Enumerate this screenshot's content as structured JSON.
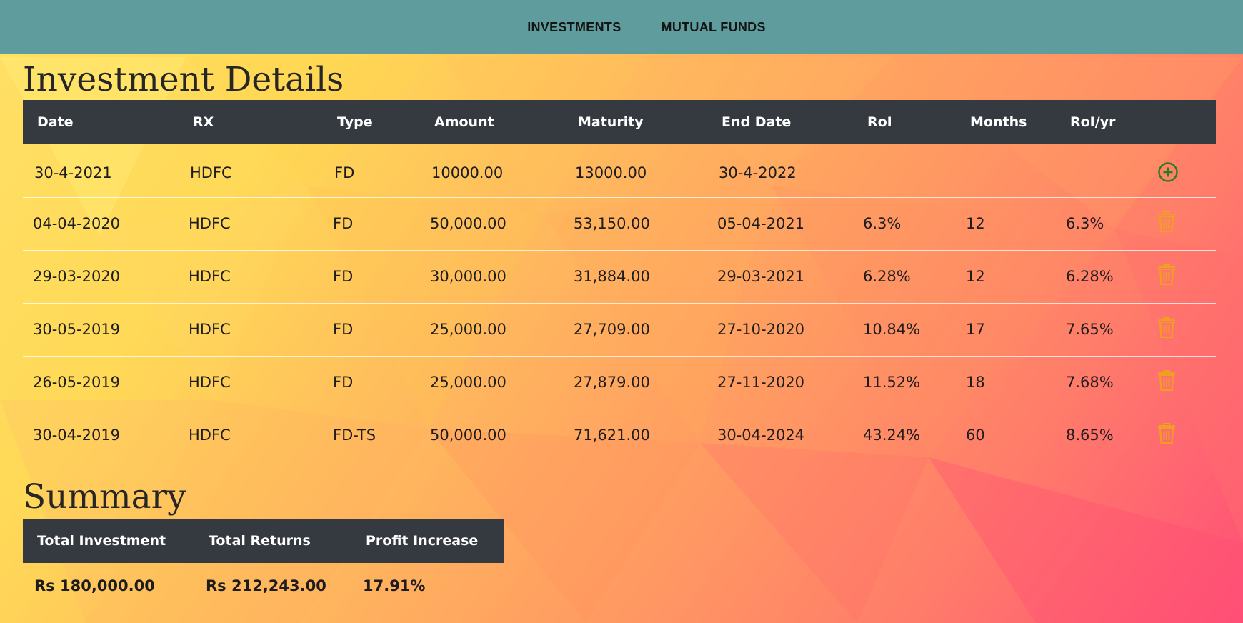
{
  "colors": {
    "navbar": "#5e9c9d",
    "table_header": "#343a40",
    "add_icon": "#2a7d1f",
    "delete_icon": "#f0a020"
  },
  "nav": {
    "items": [
      {
        "label": "INVESTMENTS"
      },
      {
        "label": "MUTUAL FUNDS"
      }
    ]
  },
  "details": {
    "title": "Investment Details",
    "columns": [
      "Date",
      "RX",
      "Type",
      "Amount",
      "Maturity",
      "End Date",
      "RoI",
      "Months",
      "RoI/yr"
    ],
    "new_entry": {
      "date": "30-4-2021",
      "rx": "HDFC",
      "type": "FD",
      "amount": "10000.00",
      "maturity": "13000.00",
      "end_date": "30-4-2022",
      "add_icon": "plus-circle-icon"
    },
    "rows": [
      {
        "date": "04-04-2020",
        "rx": "HDFC",
        "type": "FD",
        "amount": "50,000.00",
        "maturity": "53,150.00",
        "end_date": "05-04-2021",
        "roi": "6.3%",
        "months": "12",
        "roi_yr": "6.3%"
      },
      {
        "date": "29-03-2020",
        "rx": "HDFC",
        "type": "FD",
        "amount": "30,000.00",
        "maturity": "31,884.00",
        "end_date": "29-03-2021",
        "roi": "6.28%",
        "months": "12",
        "roi_yr": "6.28%"
      },
      {
        "date": "30-05-2019",
        "rx": "HDFC",
        "type": "FD",
        "amount": "25,000.00",
        "maturity": "27,709.00",
        "end_date": "27-10-2020",
        "roi": "10.84%",
        "months": "17",
        "roi_yr": "7.65%"
      },
      {
        "date": "26-05-2019",
        "rx": "HDFC",
        "type": "FD",
        "amount": "25,000.00",
        "maturity": "27,879.00",
        "end_date": "27-11-2020",
        "roi": "11.52%",
        "months": "18",
        "roi_yr": "7.68%"
      },
      {
        "date": "30-04-2019",
        "rx": "HDFC",
        "type": "FD-TS",
        "amount": "50,000.00",
        "maturity": "71,621.00",
        "end_date": "30-04-2024",
        "roi": "43.24%",
        "months": "60",
        "roi_yr": "8.65%"
      }
    ],
    "delete_icon": "trash-icon"
  },
  "summary": {
    "title": "Summary",
    "columns": [
      "Total Investment",
      "Total Returns",
      "Profit Increase"
    ],
    "values": [
      "Rs 180,000.00",
      "Rs 212,243.00",
      "17.91%"
    ]
  }
}
